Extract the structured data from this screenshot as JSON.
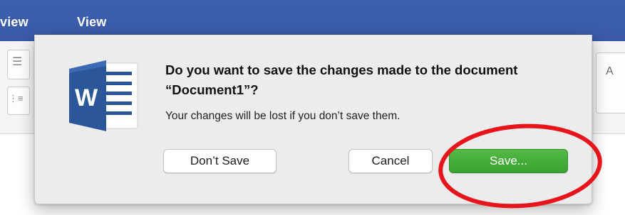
{
  "ribbon": {
    "tabs": [
      {
        "label": "view"
      },
      {
        "label": "View"
      }
    ]
  },
  "toolbar": {
    "right_glyph": "A"
  },
  "dialog": {
    "app_icon": "word-icon",
    "icon_letter": "W",
    "title": "Do you want to save the changes made to the document “Document1”?",
    "message": "Your changes will be lost if you don’t save them.",
    "buttons": {
      "dont_save": "Don’t Save",
      "cancel": "Cancel",
      "save": "Save..."
    }
  },
  "colors": {
    "ribbon_blue": "#3b5ba9",
    "save_green": "#44ad38",
    "highlight_red": "#e8141b",
    "word_blue": "#2b579a"
  }
}
